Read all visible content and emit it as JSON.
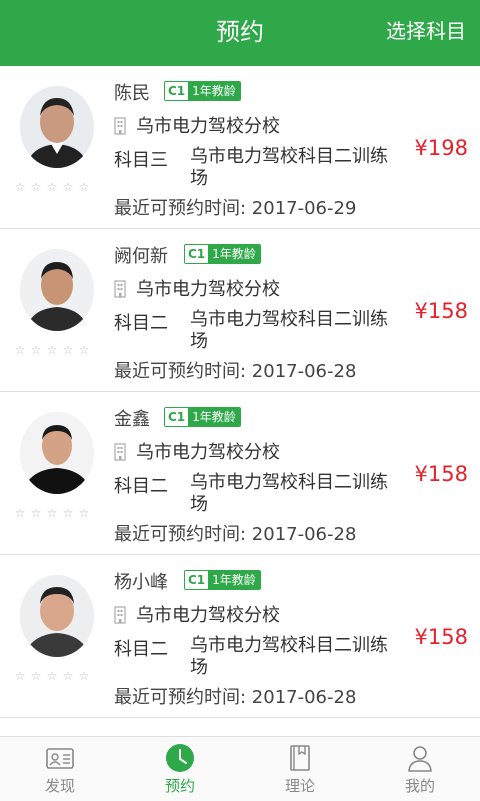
{
  "header": {
    "title": "预约",
    "action": "选择科目"
  },
  "teachers": [
    {
      "name": "陈民",
      "license": "C1",
      "years": "1年教龄",
      "school": "乌市电力驾校分校",
      "subject": "科目三",
      "site": "乌市电力驾校科目二训练场",
      "price": "¥198",
      "recent": "最近可预约时间: 2017-06-29",
      "rating": 0
    },
    {
      "name": "阙何新",
      "license": "C1",
      "years": "1年教龄",
      "school": "乌市电力驾校分校",
      "subject": "科目二",
      "site": "乌市电力驾校科目二训练场",
      "price": "¥158",
      "recent": "最近可预约时间: 2017-06-28",
      "rating": 0
    },
    {
      "name": "金鑫",
      "license": "C1",
      "years": "1年教龄",
      "school": "乌市电力驾校分校",
      "subject": "科目二",
      "site": "乌市电力驾校科目二训练场",
      "price": "¥158",
      "recent": "最近可预约时间: 2017-06-28",
      "rating": 0
    },
    {
      "name": "杨小峰",
      "license": "C1",
      "years": "1年教龄",
      "school": "乌市电力驾校分校",
      "subject": "科目二",
      "site": "乌市电力驾校科目二训练场",
      "price": "¥158",
      "recent": "最近可预约时间: 2017-06-28",
      "rating": 0
    }
  ],
  "tabs": [
    {
      "label": "发现",
      "icon": "id-card-icon"
    },
    {
      "label": "预约",
      "icon": "clock-icon"
    },
    {
      "label": "理论",
      "icon": "book-icon"
    },
    {
      "label": "我的",
      "icon": "person-icon"
    }
  ],
  "colors": {
    "brand": "#2fa84a",
    "price": "#e8202a"
  }
}
